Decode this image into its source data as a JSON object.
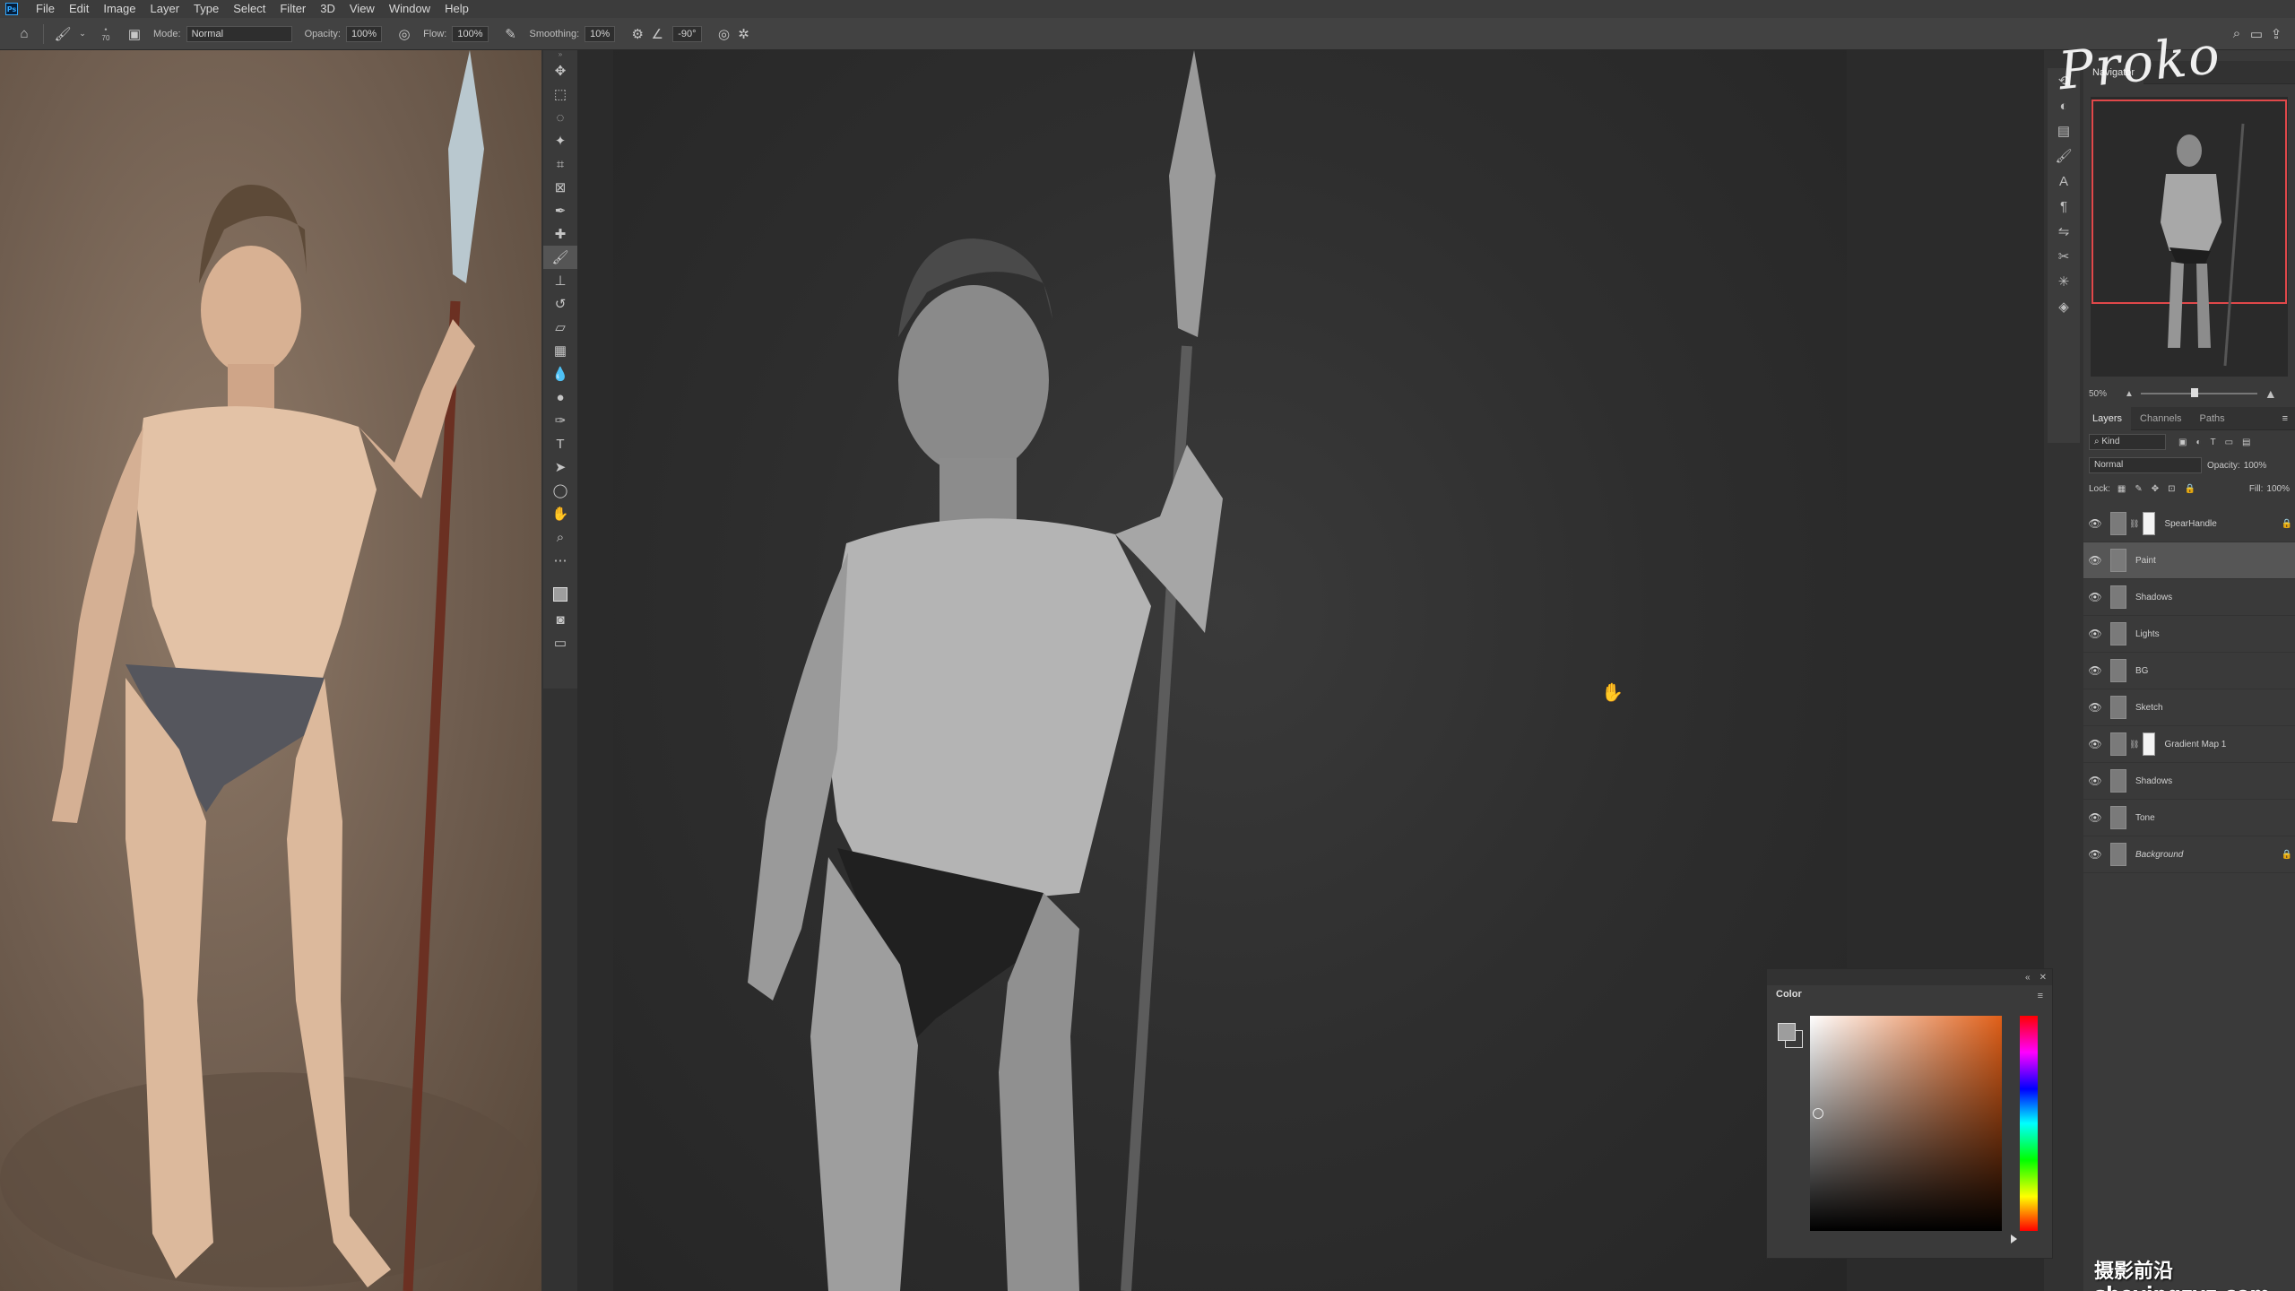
{
  "menubar": {
    "items": [
      "File",
      "Edit",
      "Image",
      "Layer",
      "Type",
      "Select",
      "Filter",
      "3D",
      "View",
      "Window",
      "Help"
    ]
  },
  "options": {
    "brush_size": "70",
    "mode_label": "Mode:",
    "mode_value": "Normal",
    "opacity_label": "Opacity:",
    "opacity_value": "100%",
    "flow_label": "Flow:",
    "flow_value": "100%",
    "smoothing_label": "Smoothing:",
    "smoothing_value": "10%",
    "angle_value": "-90°"
  },
  "tools": {
    "icons": [
      "move-icon",
      "marquee-icon",
      "lasso-icon",
      "magic-wand-icon",
      "crop-icon",
      "frame-icon",
      "eyedropper-icon",
      "healing-icon",
      "brush-icon",
      "stamp-icon",
      "history-brush-icon",
      "eraser-icon",
      "gradient-icon",
      "blur-icon",
      "dodge-icon",
      "pen-icon",
      "type-icon",
      "path-select-icon",
      "shape-icon",
      "hand-icon",
      "zoom-icon",
      "more-icon"
    ],
    "active": "brush-icon"
  },
  "navigator": {
    "tab": "Navigator",
    "zoom": "50%"
  },
  "layers_panel": {
    "tabs": [
      "Layers",
      "Channels",
      "Paths"
    ],
    "filter_label": "Kind",
    "blend_mode": "Normal",
    "opacity_label": "Opacity:",
    "opacity_value": "100%",
    "lock_label": "Lock:",
    "fill_label": "Fill:",
    "fill_value": "100%",
    "layers": [
      {
        "name": "SpearHandle",
        "selected": false,
        "mask": true,
        "locked": true,
        "italic": false
      },
      {
        "name": "Paint",
        "selected": true,
        "mask": false,
        "locked": false,
        "italic": false
      },
      {
        "name": "Shadows",
        "selected": false,
        "mask": false,
        "locked": false,
        "italic": false
      },
      {
        "name": "Lights",
        "selected": false,
        "mask": false,
        "locked": false,
        "italic": false
      },
      {
        "name": "BG",
        "selected": false,
        "mask": false,
        "locked": false,
        "italic": false
      },
      {
        "name": "Sketch",
        "selected": false,
        "mask": false,
        "locked": false,
        "italic": false
      },
      {
        "name": "Gradient Map 1",
        "selected": false,
        "mask": true,
        "locked": false,
        "italic": false
      },
      {
        "name": "Shadows",
        "selected": false,
        "mask": false,
        "locked": false,
        "italic": false
      },
      {
        "name": "Tone",
        "selected": false,
        "mask": false,
        "locked": false,
        "italic": false
      },
      {
        "name": "Background",
        "selected": false,
        "mask": false,
        "locked": true,
        "italic": true
      }
    ]
  },
  "color_panel": {
    "title": "Color",
    "hue_color": "#e05f18",
    "foreground": "#9d9d9d"
  },
  "watermarks": {
    "logo": "Proko",
    "bottom": "摄影前沿 sheyingzyz.com"
  }
}
